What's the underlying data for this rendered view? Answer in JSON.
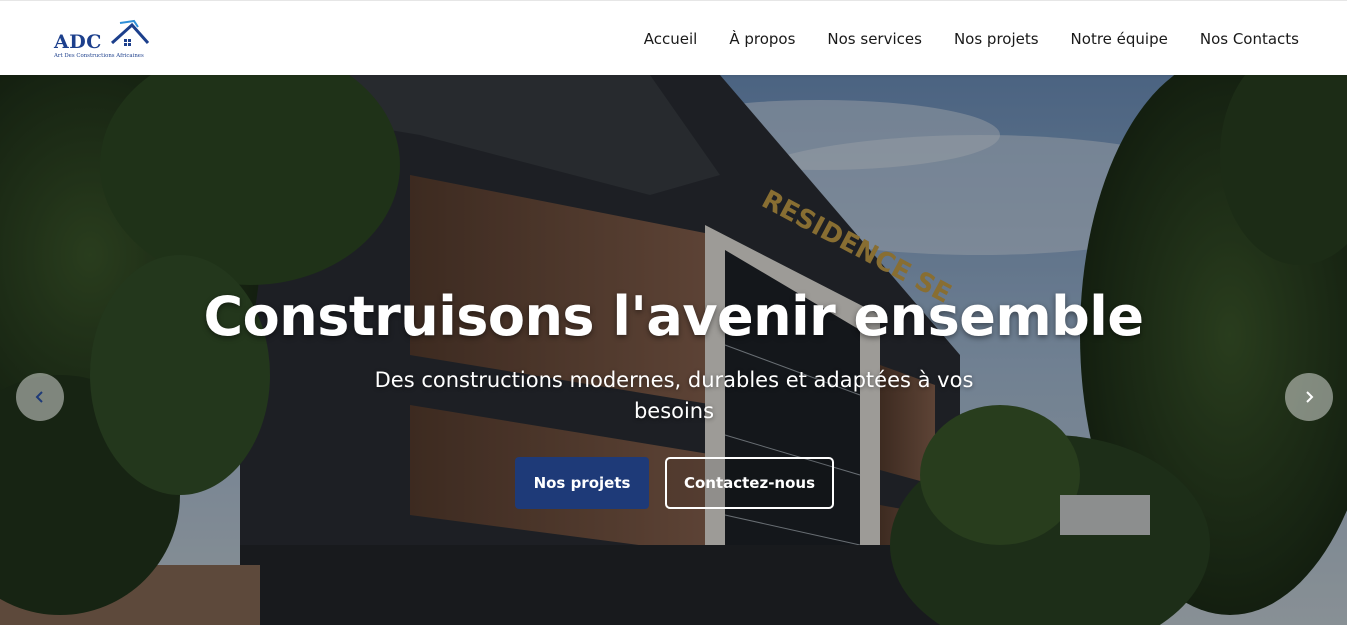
{
  "brand": {
    "logo_text": "ADC",
    "tagline": "Art Des Constructions Africaines",
    "color": "#1c3f8c"
  },
  "nav": {
    "items": [
      {
        "label": "Accueil",
        "name": "nav-accueil"
      },
      {
        "label": "À propos",
        "name": "nav-a-propos"
      },
      {
        "label": "Nos services",
        "name": "nav-nos-services"
      },
      {
        "label": "Nos projets",
        "name": "nav-nos-projets"
      },
      {
        "label": "Notre équipe",
        "name": "nav-notre-equipe"
      },
      {
        "label": "Nos Contacts",
        "name": "nav-nos-contacts"
      }
    ]
  },
  "hero": {
    "title": "Construisons l'avenir ensemble",
    "subtitle": "Des constructions modernes, durables et adaptées à vos besoins",
    "primary_button": "Nos projets",
    "secondary_button": "Contactez-nous",
    "background_sign": "RESIDENCE SE",
    "primary_color": "#1e3a78",
    "prev_icon": "chevron-left-icon",
    "next_icon": "chevron-right-icon"
  }
}
